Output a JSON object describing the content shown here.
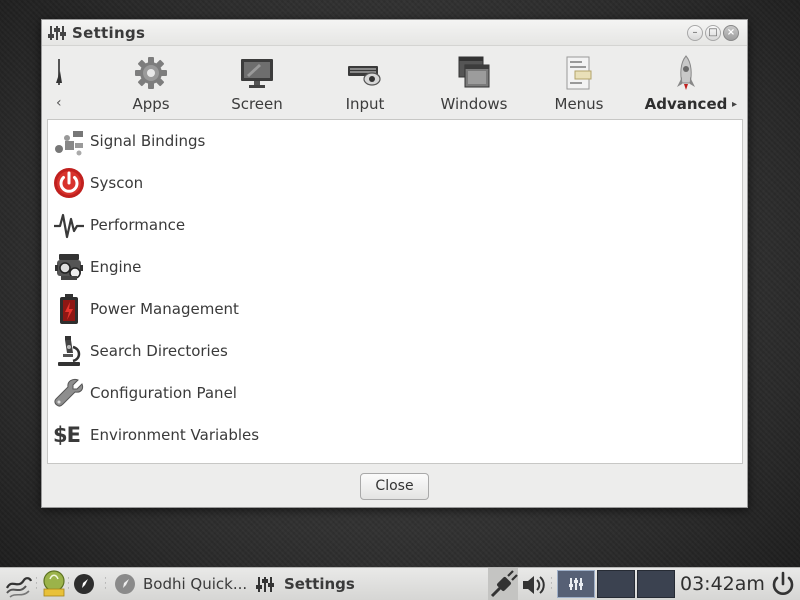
{
  "window": {
    "title": "Settings",
    "tabs": [
      {
        "label": "Apps",
        "icon": "gear-icon"
      },
      {
        "label": "Screen",
        "icon": "monitor-icon"
      },
      {
        "label": "Input",
        "icon": "keyboard-mouse-icon"
      },
      {
        "label": "Windows",
        "icon": "windows-icon"
      },
      {
        "label": "Menus",
        "icon": "menus-icon"
      },
      {
        "label": "Advanced",
        "icon": "rocket-icon",
        "active": true
      }
    ],
    "items": [
      {
        "label": "Signal Bindings",
        "icon": "signal-bindings-icon"
      },
      {
        "label": "Syscon",
        "icon": "power-icon"
      },
      {
        "label": "Performance",
        "icon": "waveform-icon"
      },
      {
        "label": "Engine",
        "icon": "engine-icon"
      },
      {
        "label": "Power Management",
        "icon": "battery-icon"
      },
      {
        "label": "Search Directories",
        "icon": "microscope-icon"
      },
      {
        "label": "Configuration Panel",
        "icon": "wrench-icon"
      },
      {
        "label": "Environment Variables",
        "icon": "env-vars-icon",
        "glyph": "$E"
      }
    ],
    "close_label": "Close"
  },
  "taskbar": {
    "tasks": [
      {
        "label": "Bodhi Quick..."
      },
      {
        "label": "Settings",
        "active": true
      }
    ],
    "clock": "03:42am"
  },
  "colors": {
    "accent_red": "#c0201e",
    "pager_active": "#566075",
    "pager": "#3b4250"
  }
}
